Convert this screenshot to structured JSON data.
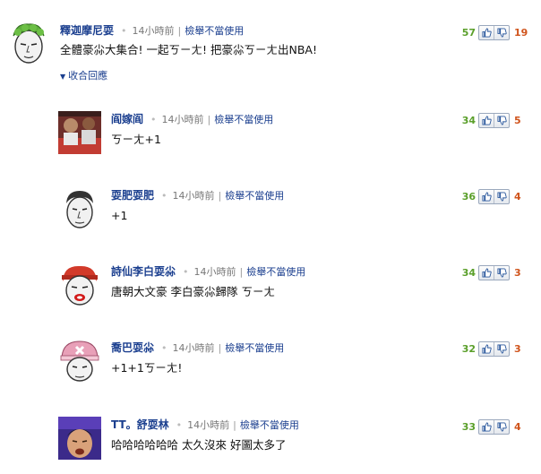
{
  "top": {
    "author": "釋迦摩尼耍",
    "time": "14小時前",
    "report": "檢舉不當使用",
    "text": "全體豪尛大集合! 一起ㄎㄧㄤ! 把豪尛ㄎㄧㄤ出NBA!",
    "collapse_label": "收合回應",
    "likes": "57",
    "dislikes": "19"
  },
  "replies": [
    {
      "author": "阎嫁阎",
      "time": "14小時前",
      "report": "檢舉不當使用",
      "text": "ㄎㄧㄤ+1",
      "likes": "34",
      "dislikes": "5"
    },
    {
      "author": "耍肥耍肥",
      "time": "14小時前",
      "report": "檢舉不當使用",
      "text": "+1",
      "likes": "36",
      "dislikes": "4"
    },
    {
      "author": "詩仙李白耍尛",
      "time": "14小時前",
      "report": "檢舉不當使用",
      "text": "唐朝大文豪 李白豪尛歸隊 ㄎㄧㄤ",
      "likes": "34",
      "dislikes": "3"
    },
    {
      "author": "喬巴耍尛",
      "time": "14小時前",
      "report": "檢舉不當使用",
      "text": "+1+1ㄎㄧㄤ!",
      "likes": "32",
      "dislikes": "3"
    },
    {
      "author": "TT。舒耍林",
      "time": "14小時前",
      "report": "檢舉不當使用",
      "text": "哈哈哈哈哈哈 太久沒來 好圖太多了",
      "likes": "33",
      "dislikes": "4"
    }
  ],
  "icons": {
    "up": "thumbs-up-icon",
    "down": "thumbs-down-icon",
    "collapse": "caret-down-icon"
  },
  "colors": {
    "link": "#1b3f8f",
    "likes": "#5a9f2a",
    "dislikes": "#d0541c"
  }
}
